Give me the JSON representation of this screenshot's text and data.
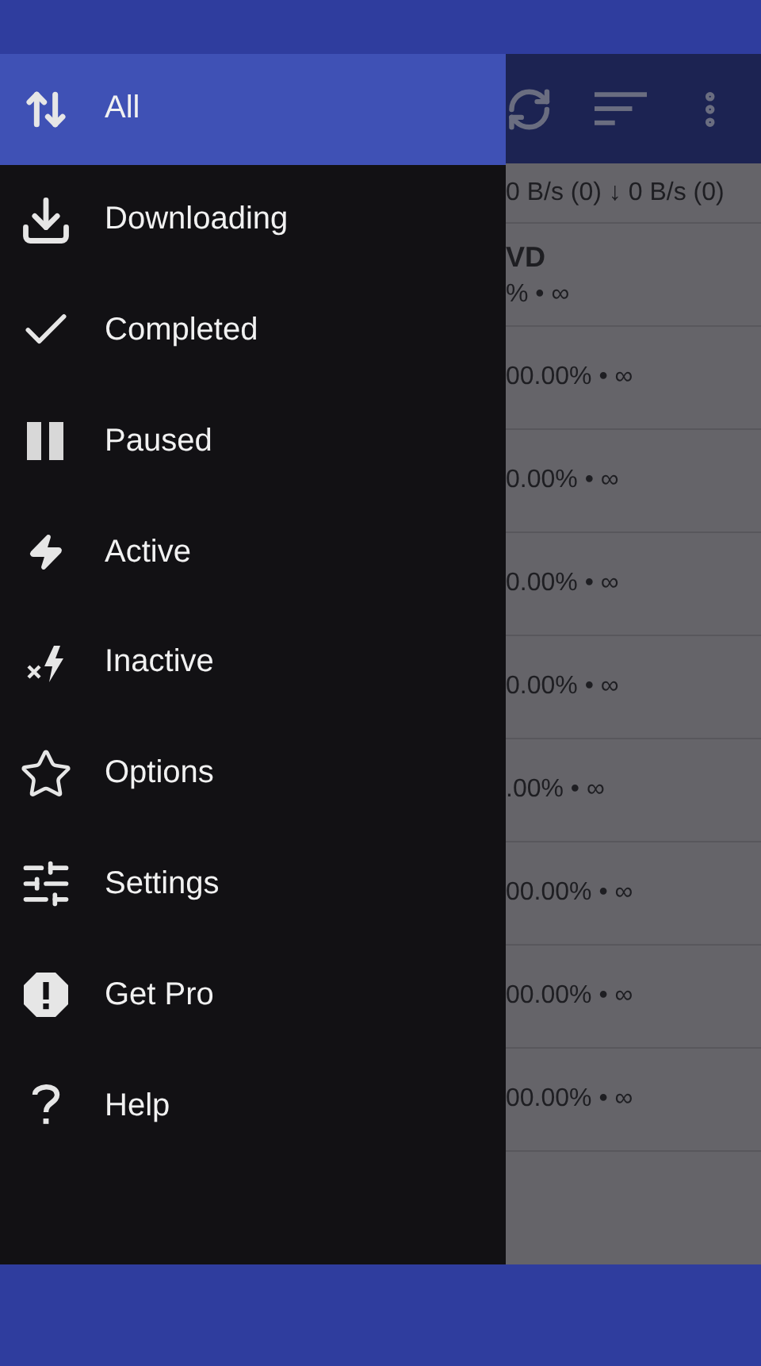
{
  "toolbar": {
    "speed": "0 B/s (0) ↓ 0 B/s (0)"
  },
  "torrents": [
    {
      "title": "VD",
      "progress": "% • ∞"
    },
    {
      "progress": "00.00% • ∞"
    },
    {
      "progress": "0.00% • ∞"
    },
    {
      "progress": "0.00% • ∞"
    },
    {
      "progress": "0.00% • ∞"
    },
    {
      "progress": ".00% • ∞"
    },
    {
      "progress": "00.00% • ∞"
    },
    {
      "progress": "00.00% • ∞"
    },
    {
      "progress": "00.00% • ∞"
    }
  ],
  "drawer": {
    "items": [
      {
        "label": "All",
        "selected": true
      },
      {
        "label": "Downloading",
        "selected": false
      },
      {
        "label": "Completed",
        "selected": false
      },
      {
        "label": "Paused",
        "selected": false
      },
      {
        "label": "Active",
        "selected": false
      },
      {
        "label": "Inactive",
        "selected": false
      },
      {
        "label": "Options",
        "selected": false
      },
      {
        "label": "Settings",
        "selected": false
      },
      {
        "label": "Get Pro",
        "selected": false
      },
      {
        "label": "Help",
        "selected": false
      }
    ]
  }
}
